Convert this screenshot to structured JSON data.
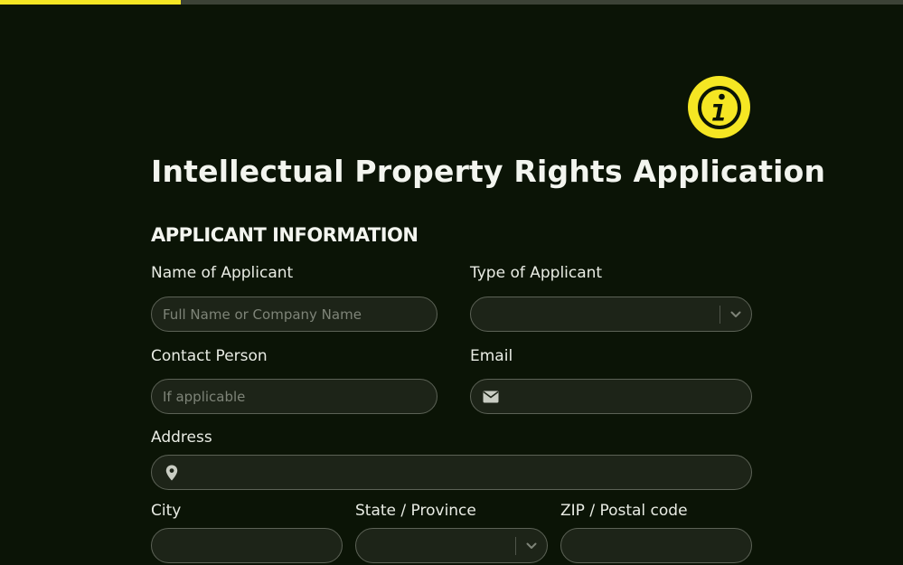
{
  "progress": {
    "fraction": 0.2,
    "fill_color": "#f5e623",
    "track_color": "#3c4236"
  },
  "header": {
    "info_icon": "info-icon",
    "title": "Intellectual Property Rights Application"
  },
  "section": {
    "title": "APPLICANT INFORMATION"
  },
  "fields": {
    "name_of_applicant": {
      "label": "Name of Applicant",
      "placeholder": "Full Name or Company Name",
      "value": ""
    },
    "type_of_applicant": {
      "label": "Type of Applicant",
      "value": "",
      "icon": "chevron-down-icon"
    },
    "contact_person": {
      "label": "Contact Person",
      "placeholder": "If applicable",
      "value": ""
    },
    "email": {
      "label": "Email",
      "value": "",
      "icon": "envelope-icon"
    },
    "address": {
      "label": "Address",
      "value": "",
      "icon": "map-pin-icon"
    },
    "city": {
      "label": "City",
      "value": ""
    },
    "state_province": {
      "label": "State / Province",
      "value": "",
      "icon": "chevron-down-icon"
    },
    "zip_postal_code": {
      "label": "ZIP / Postal code",
      "value": ""
    }
  },
  "colors": {
    "background": "#0b1406",
    "accent": "#f5e623",
    "field_background": "#1d2418",
    "field_border": "#5c6256"
  }
}
